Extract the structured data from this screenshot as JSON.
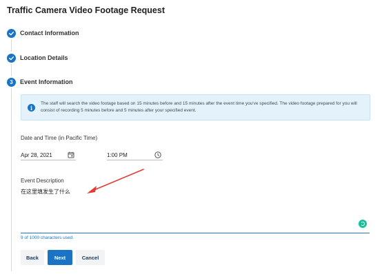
{
  "page": {
    "title": "Traffic Camera Video Footage Request"
  },
  "steps": [
    {
      "label": "Contact Information",
      "status": "complete",
      "icon": "check-icon"
    },
    {
      "label": "Location Details",
      "status": "complete",
      "icon": "check-icon"
    },
    {
      "label": "Event Information",
      "status": "current",
      "number": "3"
    }
  ],
  "info": {
    "icon": "info-icon",
    "text": "The staff will search the video footage based on 15 minutes before and 15 minutes after the event time you've specified. The video footage prepared for you will consist of recording 5 minutes before and 5 minutes after your specified event."
  },
  "datetime": {
    "label": "Date and Time (in Pacific Time)",
    "date_value": "Apr 28, 2021",
    "date_icon": "calendar-icon",
    "time_value": "1:00 PM",
    "time_icon": "clock-icon"
  },
  "description": {
    "label": "Event Description",
    "value": "在这里填发生了什么",
    "assistant_icon": "grammar-assistant-icon",
    "char_count": "9 of 1000 characters used."
  },
  "buttons": {
    "back": "Back",
    "next": "Next",
    "cancel": "Cancel"
  },
  "colors": {
    "accent": "#1a73c4",
    "info_background": "#e3f2fb",
    "annotation_arrow": "#e53935"
  }
}
